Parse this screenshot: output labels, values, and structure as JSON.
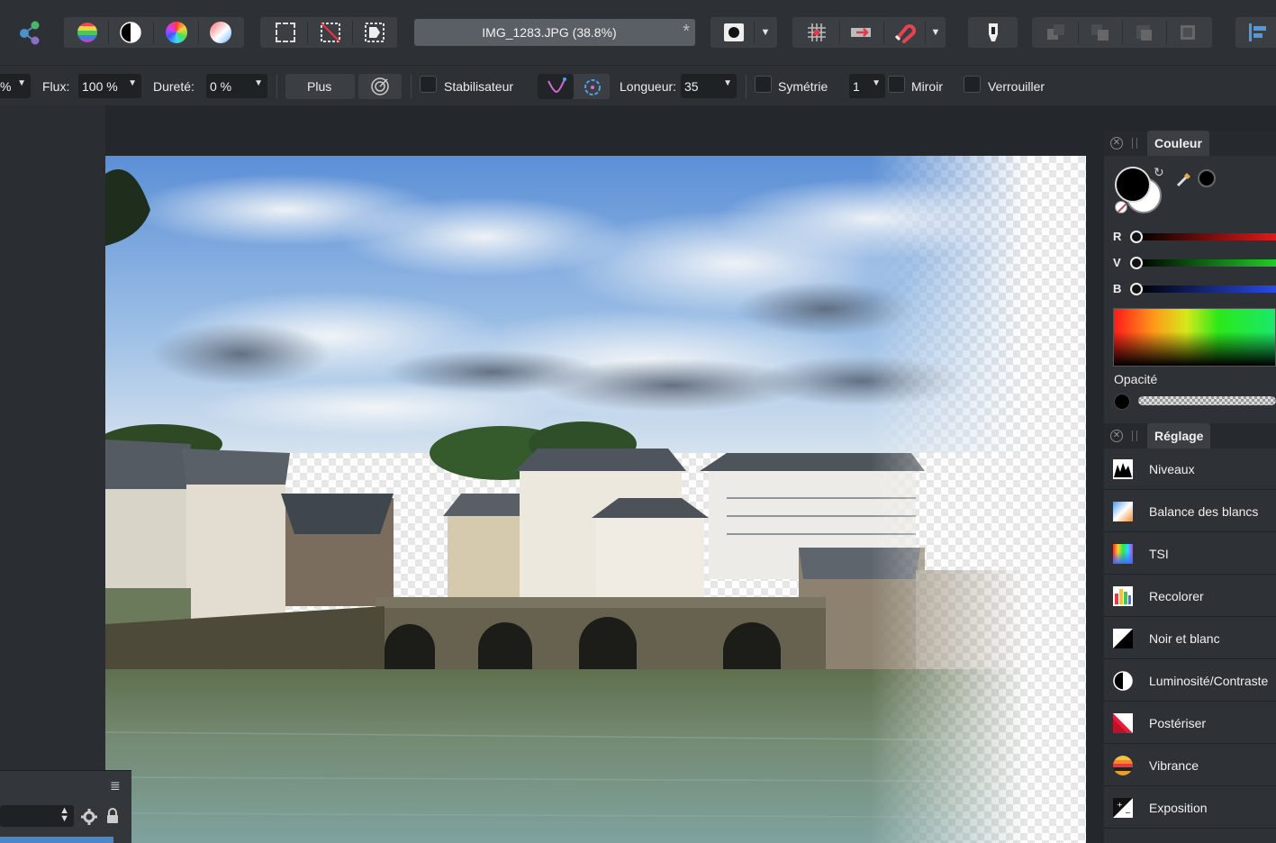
{
  "toolbar": {
    "persona_icons": [
      "share-icon"
    ],
    "adjust_icons": [
      "color-balance-icon",
      "contrast-icon",
      "hue-wheel-icon",
      "gradient-icon"
    ],
    "selection_icons": [
      "marquee-icon",
      "deselect-icon",
      "invert-selection-icon"
    ],
    "document_title": "IMG_1283.JPG (38.8%)",
    "document_close": "*",
    "right_icons": [
      "mask-icon",
      "grid-icon",
      "arrow-icon",
      "snap-magnet-icon",
      "brush-tip-icon",
      "arrange-icon",
      "align-icon"
    ]
  },
  "context": {
    "partial_value": "%",
    "flux_label": "Flux:",
    "flux_value": "100 %",
    "hardness_label": "Dureté:",
    "hardness_value": "0 %",
    "more_button": "Plus",
    "stabilizer_label": "Stabilisateur",
    "length_label": "Longueur:",
    "length_value": "35",
    "symmetry_label": "Symétrie",
    "symmetry_value": "1",
    "mirror_label": "Miroir",
    "lock_label": "Verrouiller"
  },
  "color_panel": {
    "tab": "Couleur",
    "r_label": "R",
    "g_label": "V",
    "b_label": "B",
    "opacity_label": "Opacité",
    "colors": {
      "primary": "#000000",
      "secondary": "#ffffff"
    }
  },
  "adjust_panel": {
    "tab": "Réglage",
    "items": [
      {
        "label": "Niveaux",
        "icon": "levels-icon"
      },
      {
        "label": "Balance des blancs",
        "icon": "white-balance-icon"
      },
      {
        "label": "TSI",
        "icon": "hsl-icon"
      },
      {
        "label": "Recolorer",
        "icon": "recolor-icon"
      },
      {
        "label": "Noir et blanc",
        "icon": "black-white-icon"
      },
      {
        "label": "Luminosité/Contraste",
        "icon": "brightness-contrast-icon"
      },
      {
        "label": "Postériser",
        "icon": "posterize-icon"
      },
      {
        "label": "Vibrance",
        "icon": "vibrance-icon"
      },
      {
        "label": "Exposition",
        "icon": "exposure-icon"
      }
    ]
  }
}
